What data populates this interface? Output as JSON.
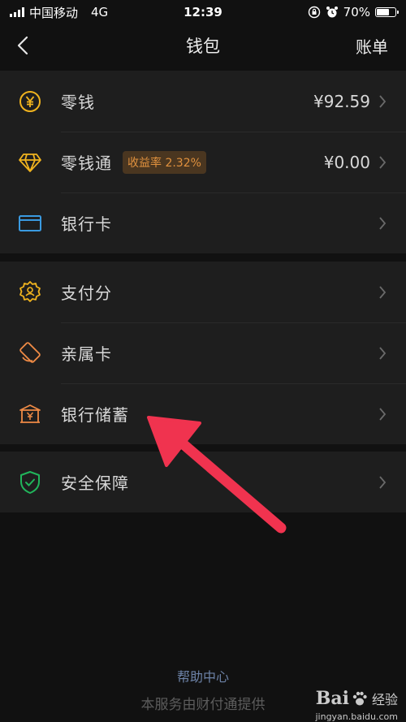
{
  "status_bar": {
    "carrier": "中国移动",
    "network": "4G",
    "time": "12:39",
    "battery_percent": "70%",
    "battery_level": 0.7
  },
  "nav": {
    "title": "钱包",
    "right_label": "账单",
    "back_icon": "chevron-left-icon"
  },
  "groups": [
    {
      "items": [
        {
          "label": "零钱",
          "value": "¥92.59",
          "icon": "yuan-coin-icon",
          "icon_color": "#f0b31e"
        },
        {
          "label": "零钱通",
          "badge": "收益率 2.32%",
          "value": "¥0.00",
          "icon": "diamond-icon",
          "icon_color": "#f0b31e"
        },
        {
          "label": "银行卡",
          "icon": "card-icon",
          "icon_color": "#3a9ae0"
        }
      ]
    },
    {
      "items": [
        {
          "label": "支付分",
          "icon": "score-badge-icon",
          "icon_color": "#f0b31e"
        },
        {
          "label": "亲属卡",
          "icon": "family-card-icon",
          "icon_color": "#ee8a45"
        },
        {
          "label": "银行储蓄",
          "icon": "bank-savings-icon",
          "icon_color": "#ee8a45"
        }
      ]
    },
    {
      "items": [
        {
          "label": "安全保障",
          "icon": "shield-check-icon",
          "icon_color": "#21b55b"
        }
      ]
    }
  ],
  "footer": {
    "help_link": "帮助中心",
    "provider_note": "本服务由财付通提供"
  },
  "watermark": {
    "brand": "Bai",
    "suffix": "经验",
    "url": "jingyan.baidu.com"
  },
  "annotation": {
    "icon": "red-arrow-icon",
    "color": "#f0334f"
  }
}
